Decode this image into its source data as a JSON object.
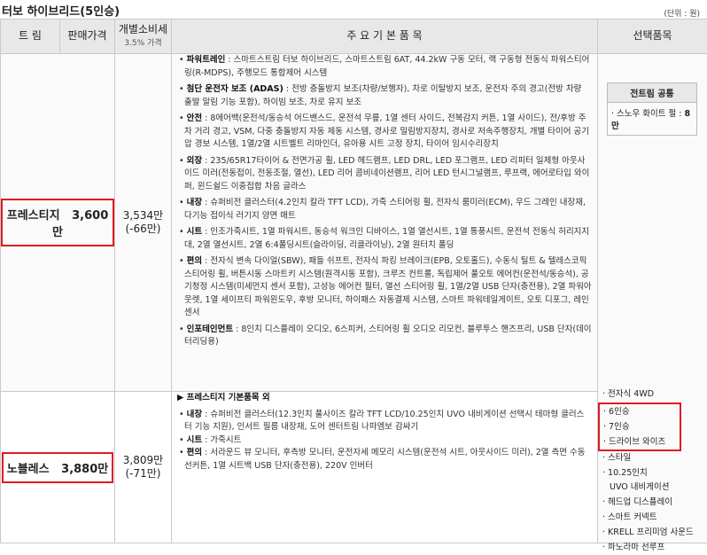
{
  "page": {
    "title": "터보 하이브리드(5인승)",
    "unit_note": "(단위 : 원)"
  },
  "headers": {
    "trim": "트 림",
    "price": "판매가격",
    "indiv": "개별소비세",
    "indiv_sub": "3.5% 가격",
    "features": "주 요 기 본 품 목",
    "options": "선택품목"
  },
  "trims": [
    {
      "name": "프레스티지",
      "price": "3,600만",
      "indiv_price": "3,534만",
      "indiv_diff": "(-66만)",
      "features": [
        {
          "label": "파워트레인",
          "text": " : 스마트스트림 터보 하이브리드, 스마트스트림 6AT, 44.2kW 구동 모터, 랙 구동형 전동식 파워스티어링(R-MDPS), 주행모드 통합제어 시스템"
        },
        {
          "label": "첨단 운전자 보조 (ADAS)",
          "text": " : 전방 충돌방지 보조(차량/보행자), 차로 이탈방지 보조, 운전자 주의 경고(전방 차량 출발 알림 기능 포함), 하이빔 보조, 차로 유지 보조"
        },
        {
          "label": "안전",
          "text": " : 8에어백(운전석/동승석 어드밴스드, 운전석 무릎, 1열 센터 사이드, 전복감지 커튼, 1열 사이드), 전/후방 주차 거리 경고, VSM, 다중 충돌방지 자동 제동 시스템, 경사로 밀림방지장치, 경사로 저속주행장치, 개별 타이어 공기압 경보 시스템, 1열/2열 시트벨트 리마인더, 유아용 시트 고정 장치, 타이어 임시수리장치"
        },
        {
          "label": "외장",
          "text": " : 235/65R17타이어 & 전면가공 휠, LED 헤드램프, LED DRL, LED 포그램프, LED 리피터 일체형 아웃사이드 미러(전동접이, 전동조절, 열선), LED 리어 콤비네이션램프, 리어 LED 턴시그널램프, 루프랙, 에어로타입 와이퍼, 윈드쉴드 이중접합 차음 글라스"
        },
        {
          "label": "내장",
          "text": " : 슈퍼비전 클러스터(4.2인치 칼라 TFT LCD), 가죽 스티어링 휠, 전자식 룸미러(ECM), 우드 그레인 내장재, 다기능 접이식 러기지 양면 매트"
        },
        {
          "label": "시트",
          "text": " : 인조가죽시트, 1열 파워시트, 동승석 워크인 디바이스, 1열 열선시트, 1열 통풍시트, 운전석 전동식 허리지지대, 2열 열선시트, 2열 6:4폴딩시트(슬라이딩, 리클라이닝), 2열 원터치 폴딩"
        },
        {
          "label": "편의",
          "text": " : 전자식 변속 다이얼(SBW), 패들 쉬프트, 전자식 파킹 브레이크(EPB, 오토홀드), 수동식 틸트 & 텔레스코픽 스티어링 휠, 버튼시동 스마트키 시스템(원격시동 포함), 크루즈 컨트롤, 독립제어 풀오토 에어컨(운전석/동승석), 공기청정 시스템(미세먼지 센서 포함), 고성능 에어컨 필터, 열선 스티어링 휠, 1열/2열 USB 단자(충전용), 2열 파워아웃렛, 1열 세이프티 파워윈도우, 후방 모니터, 하이패스 자동결제 시스템, 스마트 파워테일게이트, 오토 디포그, 레인센서"
        },
        {
          "label": "인포테인먼트",
          "text": " : 8인치 디스플레이 오디오, 6스피커, 스티어링 휠 오디오 리모컨, 블루투스 핸즈프리, USB 단자(데이터리딩용)"
        }
      ]
    },
    {
      "name": "노블레스",
      "price": "3,880만",
      "indiv_price": "3,809만",
      "indiv_diff": "(-71만)",
      "heading": "▶ 프레스티지 기본품목 외",
      "features": [
        {
          "label": "내장",
          "text": " : 슈퍼비전 클러스터(12.3인치 풀사이즈 칼라 TFT LCD/10.25인치 UVO 내비게이션 선택시 테마형 클러스터 기능 지원), 인서트 필름 내장재, 도어 센터트림 나파엠보 감싸기"
        },
        {
          "label": "시트",
          "text": " : 가죽시트"
        },
        {
          "label": "편의",
          "text": " : 서라운드 뷰 모니터, 후측방 모니터, 운전자세 메모리 시스템(운전석 시트, 아웃사이드 미러), 2열 측면 수동 선커튼, 1열 시트백 USB 단자(충전용), 220V 인버터"
        }
      ]
    }
  ],
  "options": {
    "common_title": "전트림 공통",
    "common_item_prefix": "· 스노우 화이트 펄 : ",
    "common_item_price": "8만",
    "before": [
      "· 전자식 4WD"
    ],
    "highlighted": [
      "· 6인승",
      "· 7인승",
      "· 드라이브 와이즈"
    ],
    "after": [
      "· 스타일",
      "· 10.25인치",
      "UVO 내비게이션",
      "· 헤드업 디스플레이",
      "· 스마트 커넥트",
      "· KRELL 프리미엄 사운드",
      "· 파노라마 선루프"
    ]
  }
}
